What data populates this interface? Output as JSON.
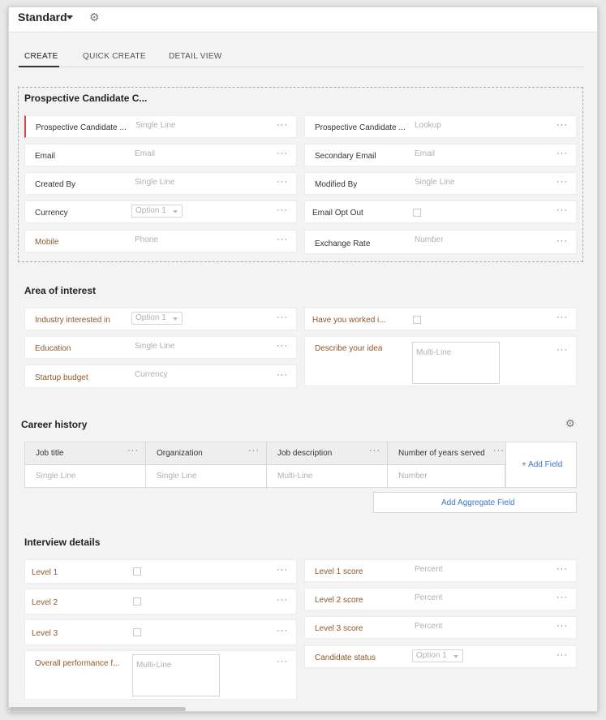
{
  "header": {
    "layout_name": "Standard"
  },
  "tabs": [
    {
      "label": "CREATE",
      "active": true
    },
    {
      "label": "QUICK CREATE",
      "active": false
    },
    {
      "label": "DETAIL VIEW",
      "active": false
    }
  ],
  "section1": {
    "title": "Prospective Candidate C...",
    "fields": [
      {
        "label": "Prospective Candidate ...",
        "placeholder": "Single Line"
      },
      {
        "label": "Prospective Candidate ...",
        "placeholder": "Lookup"
      },
      {
        "label": "Email",
        "placeholder": "Email"
      },
      {
        "label": "Secondary Email",
        "placeholder": "Email"
      },
      {
        "label": "Created By",
        "placeholder": "Single Line"
      },
      {
        "label": "Modified By",
        "placeholder": "Single Line"
      },
      {
        "label": "Currency",
        "placeholder": "Option 1"
      },
      {
        "label": "Email Opt Out"
      },
      {
        "label": "Mobile",
        "placeholder": "Phone"
      },
      {
        "label": "Exchange Rate",
        "placeholder": "Number"
      }
    ]
  },
  "section2": {
    "title": "Area of interest",
    "fields": [
      {
        "label": "Industry interested in",
        "placeholder": "Option 1"
      },
      {
        "label": "Have you worked i..."
      },
      {
        "label": "Education",
        "placeholder": "Single Line"
      },
      {
        "label": "Describe your idea",
        "placeholder": "Multi-Line"
      },
      {
        "label": "Startup budget",
        "placeholder": "Currency"
      }
    ]
  },
  "section3": {
    "title": "Career history",
    "columns": [
      {
        "header": "Job title",
        "placeholder": "Single Line"
      },
      {
        "header": "Organization",
        "placeholder": "Single Line"
      },
      {
        "header": "Job description",
        "placeholder": "Multi-Line"
      },
      {
        "header": "Number of years served",
        "placeholder": "Number"
      }
    ],
    "add_field": "+ Add Field",
    "add_aggregate": "Add Aggregate Field"
  },
  "section4": {
    "title": "Interview details",
    "fields": [
      {
        "label": "Level 1"
      },
      {
        "label": "Level 1 score",
        "placeholder": "Percent"
      },
      {
        "label": "Level 2"
      },
      {
        "label": "Level 2 score",
        "placeholder": "Percent"
      },
      {
        "label": "Level 3"
      },
      {
        "label": "Level 3 score",
        "placeholder": "Percent"
      },
      {
        "label": "Overall performance f...",
        "placeholder": "Multi-Line"
      },
      {
        "label": "Candidate status",
        "placeholder": "Option 1"
      }
    ]
  },
  "more_glyph": "···",
  "icons": {
    "settings": "gear-icon",
    "dropdown": "chevron-down-icon"
  },
  "colors": {
    "accent_link": "#3b78c4",
    "custom_label": "#8a5a2b",
    "mandatory": "#dd4444"
  }
}
